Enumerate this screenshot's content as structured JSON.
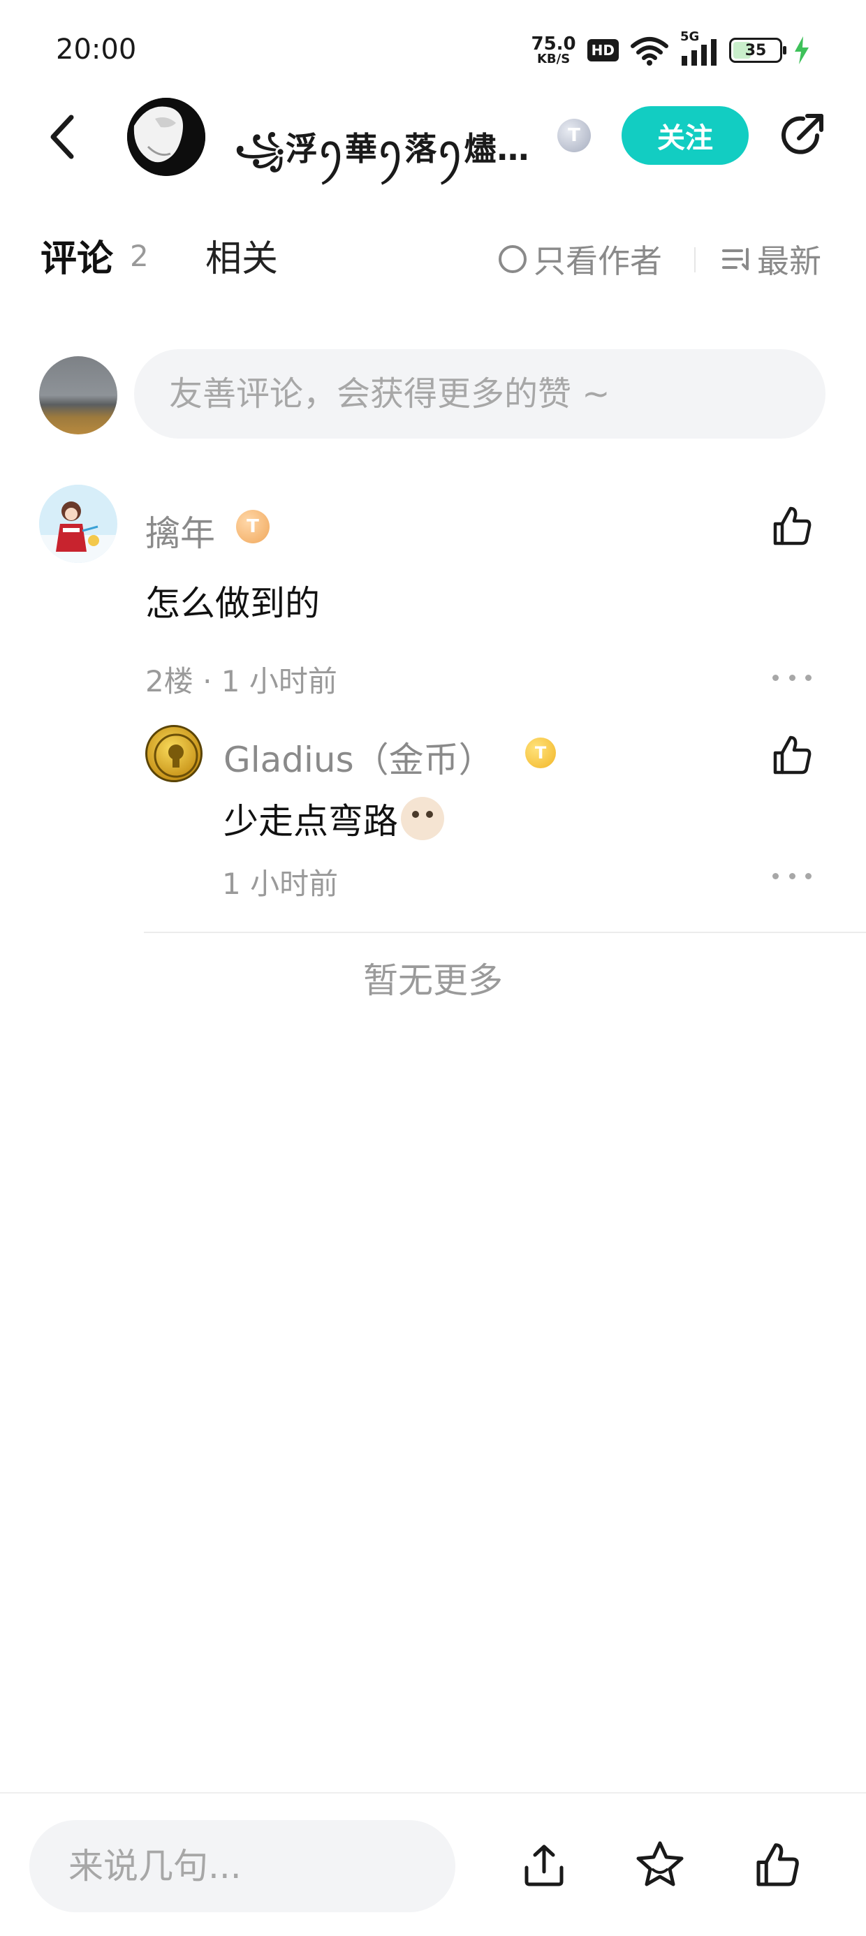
{
  "status_bar": {
    "time": "20:00",
    "net_speed_value": "75.0",
    "net_speed_unit": "KB/S",
    "hd": "HD",
    "signal": "5G",
    "battery": "35"
  },
  "header": {
    "author_name": "꧁浮ꪆ華ꪆ落ꪆ燼ꪆ...",
    "author_level_badge": "T",
    "follow_label": "关注"
  },
  "tabs": {
    "comments_label": "评论",
    "comments_count": "2",
    "related_label": "相关",
    "author_only_label": "只看作者",
    "sort_label": "最新"
  },
  "compose": {
    "placeholder": "友善评论，会获得更多的赞 ~"
  },
  "comments": [
    {
      "user": "擒年",
      "level_badge": "T",
      "text": "怎么做到的",
      "meta": "2楼 · 1 小时前",
      "replies": [
        {
          "user": "Gladius（金币）",
          "level_badge": "T",
          "text": "少走点弯路",
          "meta": "1 小时前"
        }
      ]
    }
  ],
  "no_more_label": "暂无更多",
  "bottom_bar": {
    "placeholder": "来说几句..."
  },
  "colors": {
    "accent": "#12cdc2",
    "muted_text": "#8a8a8a",
    "input_bg": "#f3f4f6"
  }
}
